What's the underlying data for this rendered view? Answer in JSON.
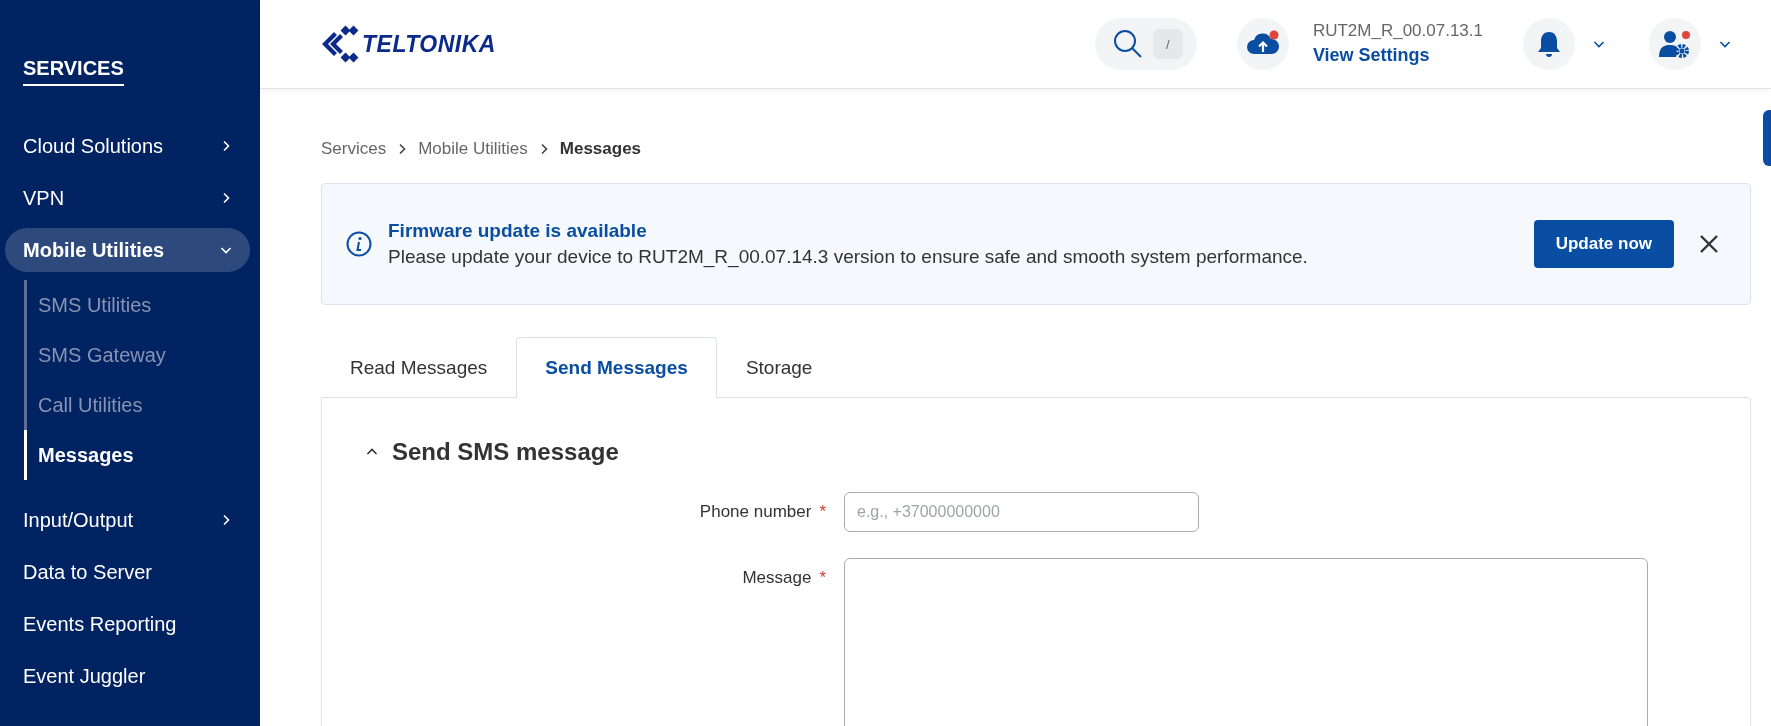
{
  "sidebar": {
    "title": "SERVICES",
    "items": [
      {
        "label": "Cloud Solutions",
        "kind": "collapsed",
        "selected": false
      },
      {
        "label": "VPN",
        "kind": "collapsed",
        "selected": false
      },
      {
        "label": "Mobile Utilities",
        "kind": "expanded",
        "selected": true,
        "children": [
          {
            "label": "SMS Utilities",
            "selected": false
          },
          {
            "label": "SMS Gateway",
            "selected": false
          },
          {
            "label": "Call Utilities",
            "selected": false
          },
          {
            "label": "Messages",
            "selected": true
          }
        ]
      },
      {
        "label": "Input/Output",
        "kind": "collapsed",
        "selected": false
      },
      {
        "label": "Data to Server",
        "kind": "plain",
        "selected": false
      },
      {
        "label": "Events Reporting",
        "kind": "plain",
        "selected": false
      },
      {
        "label": "Event Juggler",
        "kind": "plain",
        "selected": false
      }
    ]
  },
  "header": {
    "logo": "TELTONIKA",
    "search_shortcut": "/",
    "firmware_version": "RUT2M_R_00.07.13.1",
    "settings_link": "View Settings"
  },
  "breadcrumb": [
    {
      "label": "Services"
    },
    {
      "label": "Mobile Utilities"
    },
    {
      "label": "Messages"
    }
  ],
  "banner": {
    "title": "Firmware update is available",
    "text": "Please update your device to RUT2M_R_00.07.14.3 version to ensure safe and smooth system performance.",
    "button": "Update now"
  },
  "tabs": [
    {
      "label": "Read Messages",
      "selected": false
    },
    {
      "label": "Send Messages",
      "selected": true
    },
    {
      "label": "Storage",
      "selected": false
    }
  ],
  "section": {
    "title": "Send SMS message",
    "expanded": true,
    "fields": [
      {
        "label": "Phone number",
        "required_mark": "*",
        "kind": "input",
        "placeholder": "e.g., +37000000000"
      },
      {
        "label": "Message",
        "required_mark": "*",
        "kind": "textarea"
      }
    ]
  }
}
